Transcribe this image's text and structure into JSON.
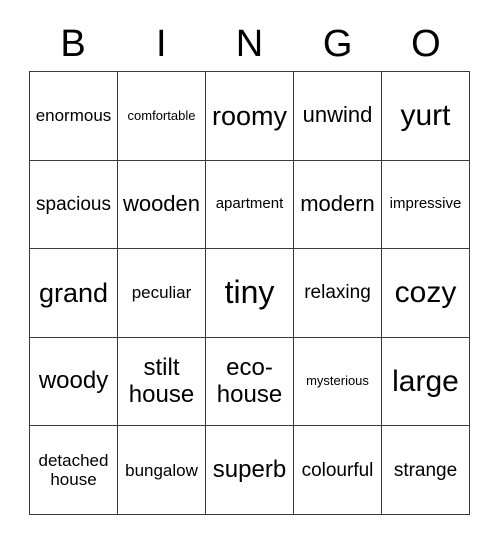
{
  "header": {
    "letters": [
      "B",
      "I",
      "N",
      "G",
      "O"
    ]
  },
  "grid": {
    "columns": 5,
    "rows": 5,
    "cells": [
      {
        "text": "enormous",
        "size": "md"
      },
      {
        "text": "comfortable",
        "size": "xs"
      },
      {
        "text": "roomy",
        "size": "3xl"
      },
      {
        "text": "unwind",
        "size": "xl"
      },
      {
        "text": "yurt",
        "size": "4xl"
      },
      {
        "text": "spacious",
        "size": "lg"
      },
      {
        "text": "wooden",
        "size": "xl"
      },
      {
        "text": "apartment",
        "size": "sm"
      },
      {
        "text": "modern",
        "size": "xl"
      },
      {
        "text": "impressive",
        "size": "sm"
      },
      {
        "text": "grand",
        "size": "3xl"
      },
      {
        "text": "peculiar",
        "size": "md"
      },
      {
        "text": "tiny",
        "size": "5xl"
      },
      {
        "text": "relaxing",
        "size": "lg"
      },
      {
        "text": "cozy",
        "size": "4xl"
      },
      {
        "text": "woody",
        "size": "2xl"
      },
      {
        "text": "stilt house",
        "size": "2xl"
      },
      {
        "text": "eco-house",
        "size": "2xl"
      },
      {
        "text": "mysterious",
        "size": "xs"
      },
      {
        "text": "large",
        "size": "4xl"
      },
      {
        "text": "detached house",
        "size": "md"
      },
      {
        "text": "bungalow",
        "size": "md"
      },
      {
        "text": "superb",
        "size": "2xl"
      },
      {
        "text": "colourful",
        "size": "lg"
      },
      {
        "text": "strange",
        "size": "lg"
      }
    ]
  },
  "colors": {
    "background": "#ffffff",
    "border": "#3a3a3a",
    "text": "#000000"
  }
}
